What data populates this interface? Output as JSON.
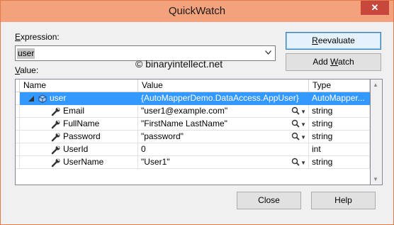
{
  "window": {
    "title": "QuickWatch",
    "close_glyph": "✕"
  },
  "expression": {
    "label": "Expression:",
    "label_ul": "E",
    "label_rest": "xpression:",
    "value": "user"
  },
  "watermark": "© binaryintellect.net",
  "value_label": {
    "ul": "V",
    "rest": "alue:"
  },
  "buttons": {
    "reevaluate": {
      "ul": "R",
      "rest": "eevaluate"
    },
    "add_watch": {
      "pre": "Add ",
      "ul": "W",
      "rest": "atch"
    },
    "close": "Close",
    "help": "Help"
  },
  "grid": {
    "columns": [
      "Name",
      "Value",
      "Type"
    ],
    "rows": [
      {
        "name": "user",
        "value": "{AutoMapperDemo.DataAccess.AppUser}",
        "type": "AutoMapper...",
        "icon": "object-icon",
        "expander": true,
        "selected": true,
        "search": false
      },
      {
        "name": "Email",
        "value": "\"user1@example.com\"",
        "type": "string",
        "icon": "wrench-icon",
        "search": true
      },
      {
        "name": "FullName",
        "value": "\"FirstName LastName\"",
        "type": "string",
        "icon": "wrench-icon",
        "search": true
      },
      {
        "name": "Password",
        "value": "\"password\"",
        "type": "string",
        "icon": "wrench-icon",
        "search": true
      },
      {
        "name": "UserId",
        "value": "0",
        "type": "int",
        "icon": "wrench-icon",
        "search": false
      },
      {
        "name": "UserName",
        "value": "\"User1\"",
        "type": "string",
        "icon": "wrench-icon",
        "search": true
      }
    ]
  },
  "colors": {
    "titlebar": "#f4a27b",
    "close_button": "#c7473c",
    "selection": "#3399ff"
  }
}
